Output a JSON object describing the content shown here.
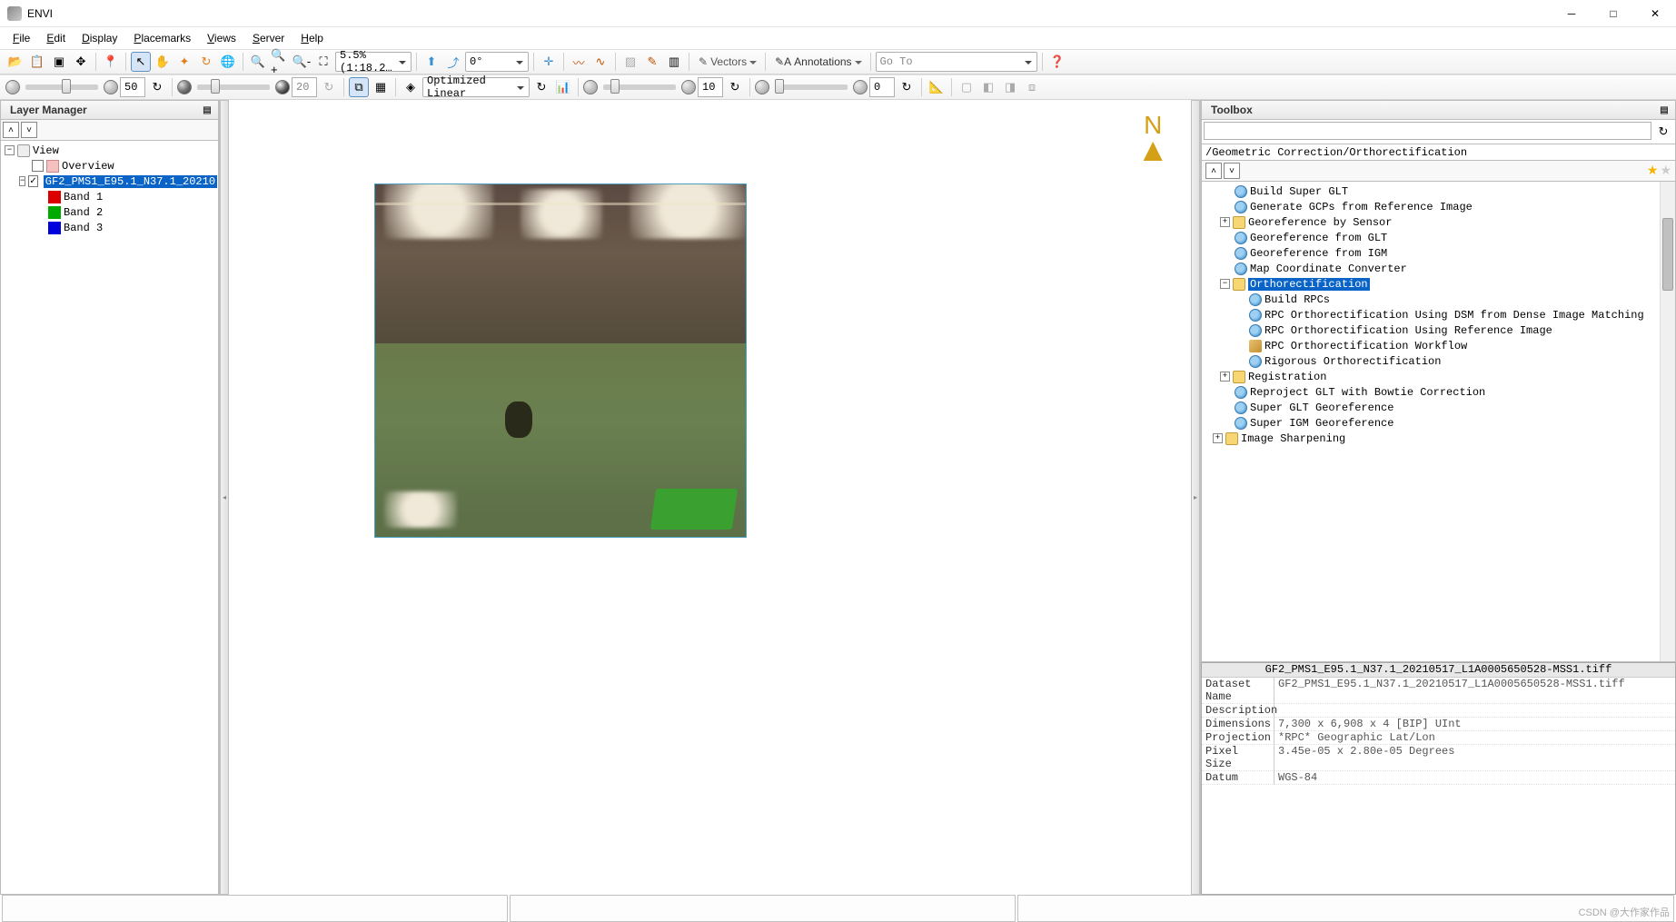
{
  "window": {
    "title": "ENVI"
  },
  "menu": {
    "file": "File",
    "edit": "Edit",
    "display": "Display",
    "placemarks": "Placemarks",
    "views": "Views",
    "server": "Server",
    "help": "Help"
  },
  "toolbar1": {
    "zoom_value": "5.5% (1:18.2…",
    "rotation": "0°",
    "vectors": "Vectors",
    "annotations": "Annotations",
    "goto": "Go To"
  },
  "toolbar2": {
    "val1": "50",
    "val2": "20",
    "stretch": "Optimized Linear",
    "val3": "10",
    "val4": "0"
  },
  "layer_panel": {
    "title": "Layer Manager",
    "view": "View",
    "overview": "Overview",
    "image": "GF2_PMS1_E95.1_N37.1_20210",
    "band1": "Band 1",
    "band2": "Band 2",
    "band3": "Band 3"
  },
  "north_label": "N",
  "toolbox": {
    "title": "Toolbox",
    "breadcrumb": "/Geometric Correction/Orthorectification",
    "items": {
      "build_super_glt": "Build Super GLT",
      "gen_gcps": "Generate GCPs from Reference Image",
      "georef_sensor": "Georeference by Sensor",
      "georef_glt": "Georeference from GLT",
      "georef_igm": "Georeference from IGM",
      "map_coord": "Map Coordinate Converter",
      "ortho": "Orthorectification",
      "build_rpcs": "Build RPCs",
      "rpc_dsm": "RPC Orthorectification Using DSM from Dense Image Matching",
      "rpc_ref": "RPC Orthorectification Using Reference Image",
      "rpc_wf": "RPC Orthorectification Workflow",
      "rigorous": "Rigorous Orthorectification",
      "registration": "Registration",
      "reproject": "Reproject GLT with Bowtie Correction",
      "super_glt": "Super GLT Georeference",
      "super_igm": "Super IGM Georeference",
      "sharpening": "Image Sharpening"
    }
  },
  "metadata": {
    "title": "GF2_PMS1_E95.1_N37.1_20210517_L1A0005650528-MSS1.tiff",
    "rows": {
      "dataset_name_k": "Dataset Name",
      "dataset_name_v": "GF2_PMS1_E95.1_N37.1_20210517_L1A0005650528-MSS1.tiff",
      "description_k": "Description",
      "description_v": "",
      "dimensions_k": "Dimensions",
      "dimensions_v": "7,300 x 6,908 x 4 [BIP] UInt",
      "projection_k": "Projection",
      "projection_v": "*RPC* Geographic Lat/Lon",
      "pixel_size_k": "Pixel Size",
      "pixel_size_v": "3.45e-05 x 2.80e-05 Degrees",
      "datum_k": "Datum",
      "datum_v": "WGS-84"
    }
  },
  "watermark": "CSDN @大作家作品"
}
